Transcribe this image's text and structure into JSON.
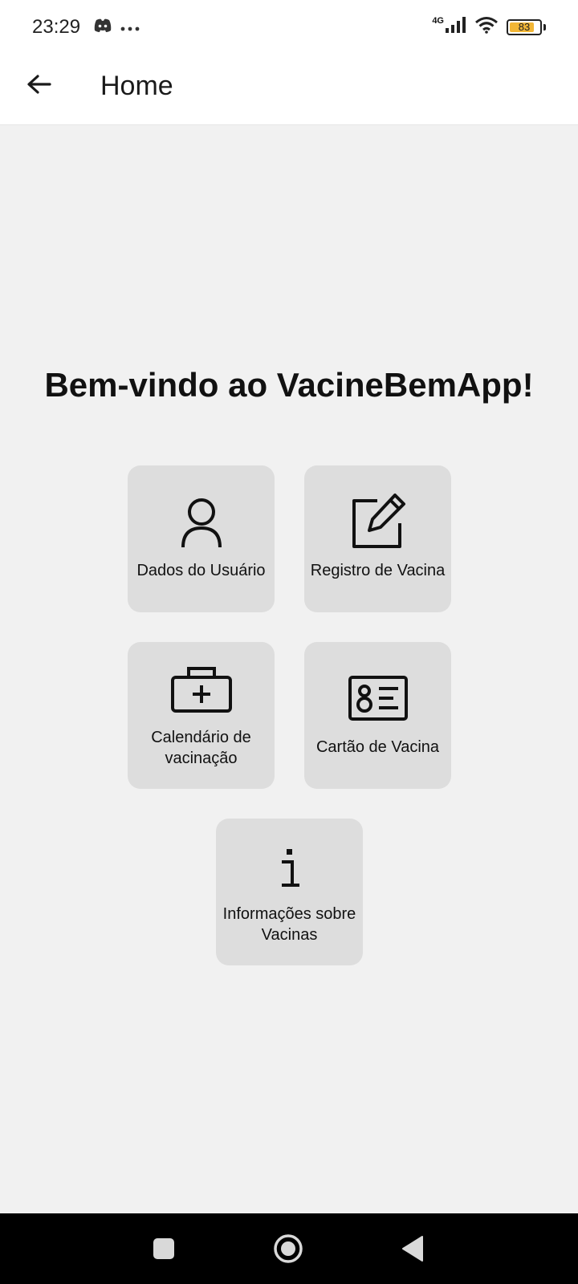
{
  "status": {
    "time": "23:29",
    "network": "4G",
    "battery": "83",
    "battery_level": 0.83
  },
  "header": {
    "title": "Home"
  },
  "main": {
    "welcome": "Bem-vindo ao VacineBemApp!",
    "cards": [
      {
        "label": "Dados do Usuário",
        "icon": "user-icon"
      },
      {
        "label": "Registro de Vacina",
        "icon": "edit-icon"
      },
      {
        "label": "Calendário de vacinação",
        "icon": "medical-kit-icon"
      },
      {
        "label": "Cartão de Vacina",
        "icon": "id-card-icon"
      },
      {
        "label": "Informações sobre Vacinas",
        "icon": "info-icon"
      }
    ]
  },
  "colors": {
    "background": "#f1f1f1",
    "card": "#dddddd",
    "battery": "#f2b636",
    "nav_bar": "#000000"
  }
}
